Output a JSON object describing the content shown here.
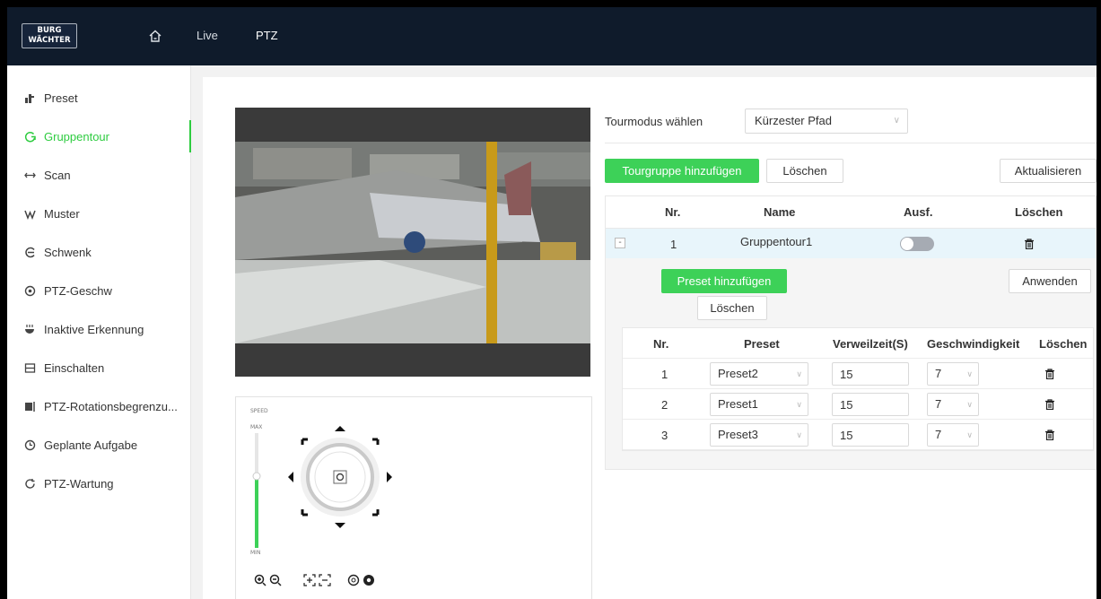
{
  "app": {
    "logo_line1": "BURG",
    "logo_line2": "WÄCHTER",
    "nav": {
      "live": "Live",
      "ptz": "PTZ"
    }
  },
  "sidebar": {
    "items": [
      {
        "label": "Preset",
        "icon": "preset-icon",
        "active": false
      },
      {
        "label": "Gruppentour",
        "icon": "tour-icon",
        "active": true
      },
      {
        "label": "Scan",
        "icon": "scan-icon",
        "active": false
      },
      {
        "label": "Muster",
        "icon": "pattern-icon",
        "active": false
      },
      {
        "label": "Schwenk",
        "icon": "pan-icon",
        "active": false
      },
      {
        "label": "PTZ-Geschw",
        "icon": "speed-icon",
        "active": false
      },
      {
        "label": "Inaktive Erkennung",
        "icon": "idle-icon",
        "active": false
      },
      {
        "label": "Einschalten",
        "icon": "power-up-icon",
        "active": false
      },
      {
        "label": "PTZ-Rotationsbegrenzu...",
        "icon": "limit-icon",
        "active": false
      },
      {
        "label": "Geplante Aufgabe",
        "icon": "clock-icon",
        "active": false
      },
      {
        "label": "PTZ-Wartung",
        "icon": "refresh-icon",
        "active": false
      }
    ]
  },
  "ptz_control": {
    "speed_label": "SPEED",
    "max_label": "MAX",
    "min_label": "MIN"
  },
  "tour": {
    "mode_label": "Tourmodus wählen",
    "mode_value": "Kürzester Pfad",
    "add_group_button": "Tourgruppe hinzufügen",
    "delete_button": "Löschen",
    "refresh_button": "Aktualisieren",
    "table_headers": {
      "nr": "Nr.",
      "name": "Name",
      "exec": "Ausf.",
      "delete": "Löschen"
    },
    "row": {
      "nr": "1",
      "name": "Gruppentour1",
      "enabled": false
    },
    "add_preset_button": "Preset hinzufügen",
    "apply_button": "Anwenden",
    "delete_preset_button": "Löschen",
    "preset_headers": {
      "nr": "Nr.",
      "preset": "Preset",
      "dwell": "Verweilzeit(S)",
      "speed": "Geschwindigkeit",
      "delete": "Löschen"
    },
    "presets": [
      {
        "nr": "1",
        "preset": "Preset2",
        "dwell": "15",
        "speed": "7"
      },
      {
        "nr": "2",
        "preset": "Preset1",
        "dwell": "15",
        "speed": "7"
      },
      {
        "nr": "3",
        "preset": "Preset3",
        "dwell": "15",
        "speed": "7"
      }
    ]
  },
  "colors": {
    "accent": "#3dd158",
    "topbar": "#0f1b2b"
  }
}
